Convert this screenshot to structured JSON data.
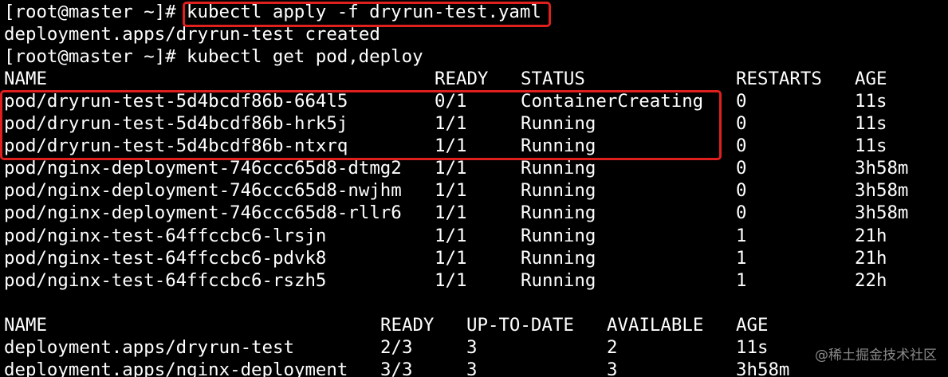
{
  "terminal": {
    "lines": [
      {
        "prompt": "[root@master ~]# ",
        "command": "kubectl apply -f dryrun-test.yaml"
      },
      {
        "text": "deployment.apps/dryrun-test created"
      },
      {
        "prompt": "[root@master ~]# ",
        "command": "kubectl get pod,deploy"
      }
    ],
    "pods": {
      "headers": [
        "NAME",
        "READY",
        "STATUS",
        "RESTARTS",
        "AGE"
      ],
      "rows": [
        [
          "pod/dryrun-test-5d4bcdf86b-664l5",
          "0/1",
          "ContainerCreating",
          "0",
          "11s"
        ],
        [
          "pod/dryrun-test-5d4bcdf86b-hrk5j",
          "1/1",
          "Running",
          "0",
          "11s"
        ],
        [
          "pod/dryrun-test-5d4bcdf86b-ntxrq",
          "1/1",
          "Running",
          "0",
          "11s"
        ],
        [
          "pod/nginx-deployment-746ccc65d8-dtmg2",
          "1/1",
          "Running",
          "0",
          "3h58m"
        ],
        [
          "pod/nginx-deployment-746ccc65d8-nwjhm",
          "1/1",
          "Running",
          "0",
          "3h58m"
        ],
        [
          "pod/nginx-deployment-746ccc65d8-rllr6",
          "1/1",
          "Running",
          "0",
          "3h58m"
        ],
        [
          "pod/nginx-test-64ffccbc6-lrsjn",
          "1/1",
          "Running",
          "1",
          "21h"
        ],
        [
          "pod/nginx-test-64ffccbc6-pdvk8",
          "1/1",
          "Running",
          "1",
          "21h"
        ],
        [
          "pod/nginx-test-64ffccbc6-rszh5",
          "1/1",
          "Running",
          "1",
          "22h"
        ]
      ]
    },
    "deployments": {
      "headers": [
        "NAME",
        "READY",
        "UP-TO-DATE",
        "AVAILABLE",
        "AGE"
      ],
      "rows": [
        [
          "deployment.apps/dryrun-test",
          "2/3",
          "3",
          "2",
          "11s"
        ],
        [
          "deployment.apps/nginx-deployment",
          "3/3",
          "3",
          "3",
          "3h58m"
        ]
      ]
    }
  },
  "watermark": "@稀土掘金技术社区",
  "colors": {
    "background": "#000000",
    "text": "#ffffff",
    "highlight": "#e0201f",
    "watermark": "#8a8a8a"
  }
}
